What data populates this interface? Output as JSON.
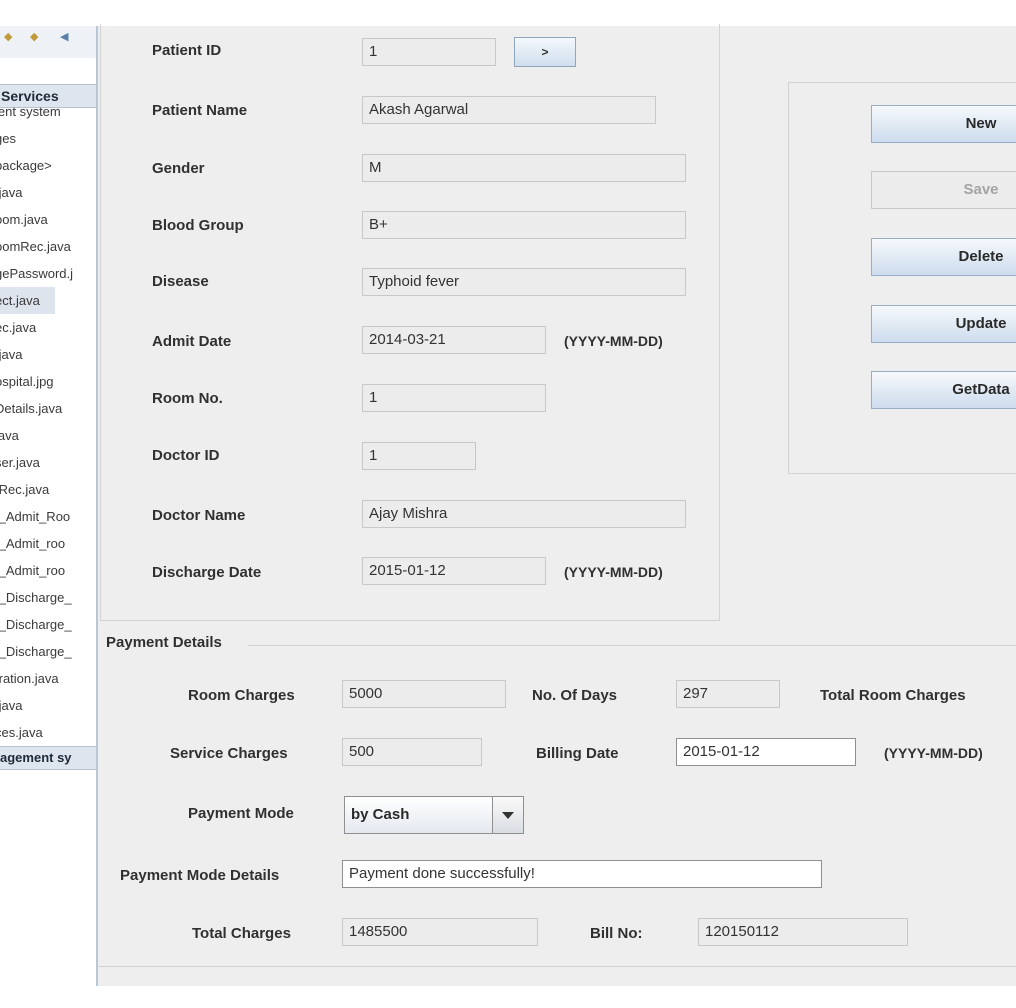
{
  "tree": {
    "header": "Services",
    "items": [
      "ient system",
      "ges",
      "package>",
      ".java",
      "oom.java",
      "oomRec.java",
      "gePassword.j",
      "ect.java",
      "ec.java",
      ".java",
      "ospital.jpg",
      "Details.java",
      "java",
      "ser.java",
      "tRec.java",
      "t_Admit_Roo",
      "t_Admit_roo",
      "t_Admit_roo",
      "t_Discharge_",
      "t_Discharge_",
      "t_Discharge_",
      "tration.java",
      ".java",
      "ces.java"
    ],
    "footer": "agement sy"
  },
  "patient": {
    "patient_id_label": "Patient ID",
    "patient_id_value": "1",
    "go_button": ">",
    "patient_name_label": "Patient Name",
    "patient_name_value": "Akash Agarwal",
    "gender_label": "Gender",
    "gender_value": "M",
    "blood_group_label": "Blood Group",
    "blood_group_value": "B+",
    "disease_label": "Disease",
    "disease_value": "Typhoid fever",
    "admit_date_label": "Admit Date",
    "admit_date_value": "2014-03-21",
    "admit_date_hint": "(YYYY-MM-DD)",
    "room_no_label": "Room No.",
    "room_no_value": "1",
    "doctor_id_label": "Doctor ID",
    "doctor_id_value": "1",
    "doctor_name_label": "Doctor Name",
    "doctor_name_value": "Ajay Mishra",
    "discharge_date_label": "Discharge Date",
    "discharge_date_value": "2015-01-12",
    "discharge_date_hint": "(YYYY-MM-DD)"
  },
  "actions": {
    "new": "New",
    "save": "Save",
    "delete": "Delete",
    "update": "Update",
    "getdata": "GetData"
  },
  "payment": {
    "title": "Payment Details",
    "room_charges_label": "Room Charges",
    "room_charges_value": "5000",
    "no_of_days_label": "No. Of Days",
    "no_of_days_value": "297",
    "total_room_charges_label": "Total Room Charges",
    "service_charges_label": "Service Charges",
    "service_charges_value": "500",
    "billing_date_label": "Billing Date",
    "billing_date_value": "2015-01-12",
    "billing_date_hint": "(YYYY-MM-DD)",
    "payment_mode_label": "Payment Mode",
    "payment_mode_value": "by Cash",
    "payment_mode_details_label": "Payment Mode Details",
    "payment_mode_details_value": "Payment done successfully!",
    "total_charges_label": "Total Charges",
    "total_charges_value": "1485500",
    "bill_no_label": "Bill No:",
    "bill_no_value": "120150112"
  }
}
